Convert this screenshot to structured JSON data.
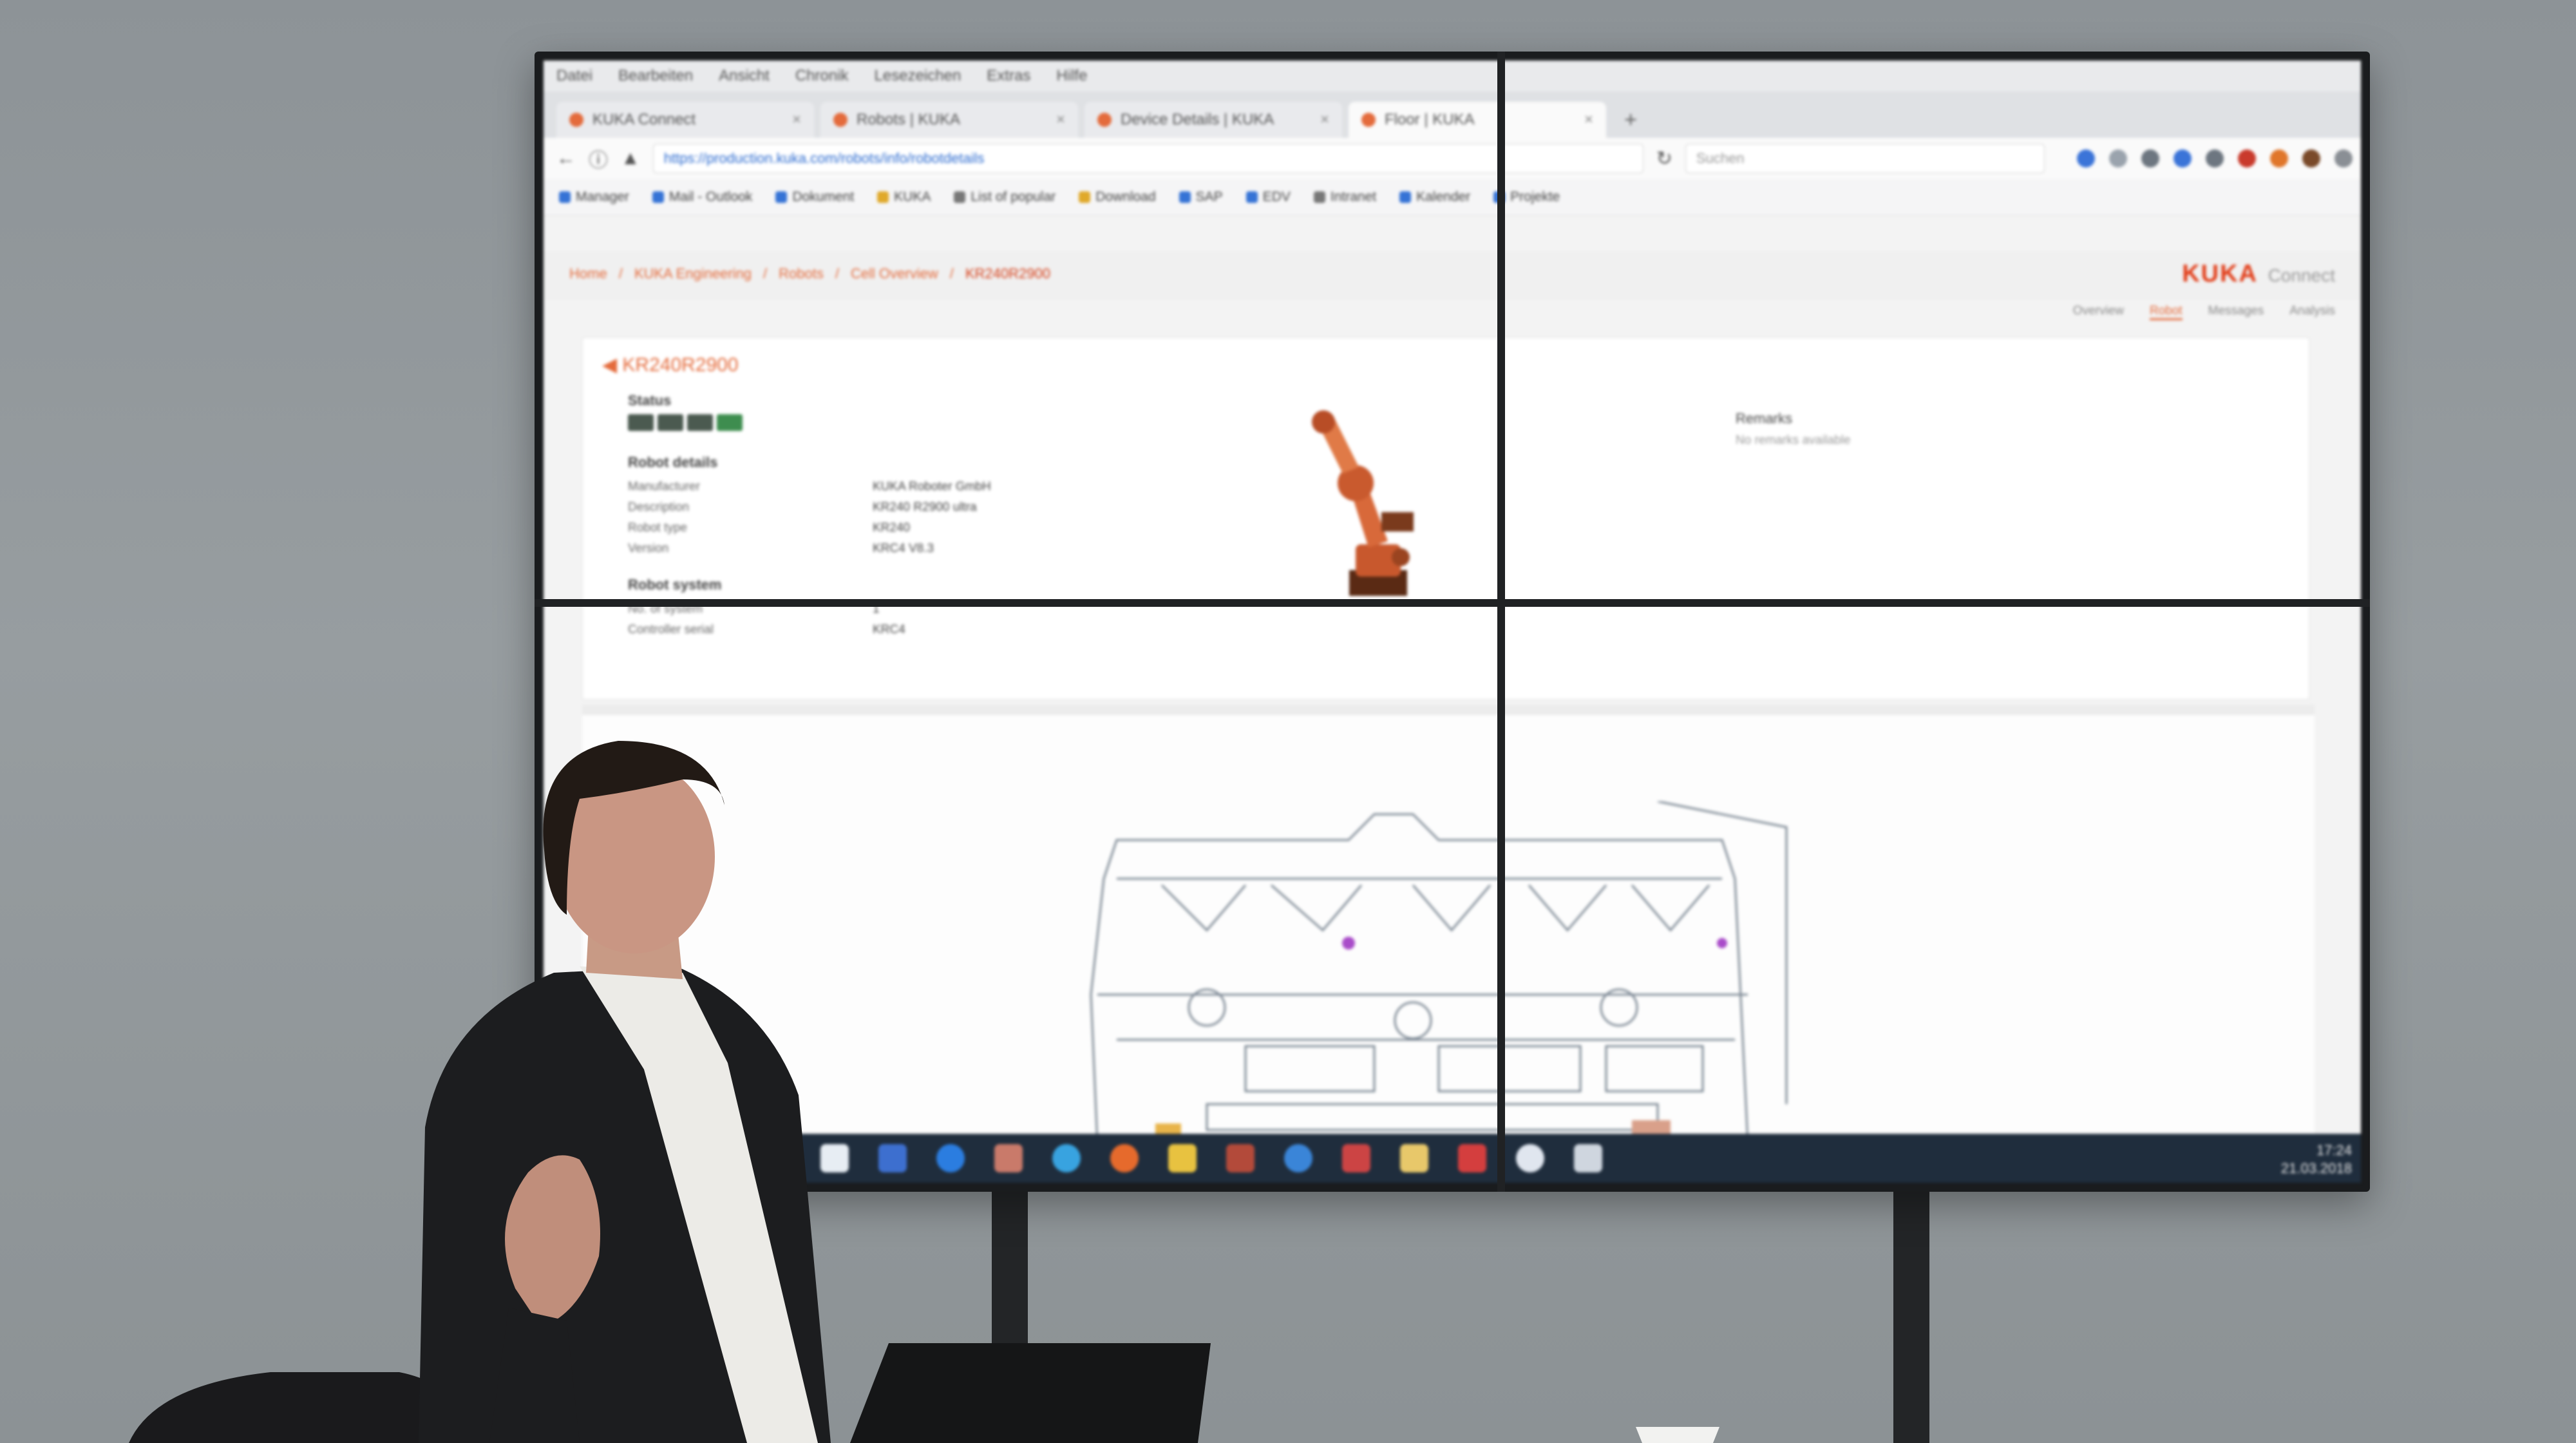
{
  "browser": {
    "menu": [
      "Datei",
      "Bearbeiten",
      "Ansicht",
      "Chronik",
      "Lesezeichen",
      "Extras",
      "Hilfe"
    ],
    "tabs": [
      {
        "label": "KUKA Connect",
        "active": false
      },
      {
        "label": "Robots | KUKA",
        "active": false
      },
      {
        "label": "Device Details | KUKA",
        "active": false
      },
      {
        "label": "Floor | KUKA",
        "active": true
      }
    ],
    "new_tab": "+",
    "url": "https://production.kuka.com/robots/info/robotdetails",
    "search_placeholder": "Suchen",
    "bookmarks": [
      "Manager",
      "Mail - Outlook",
      "Dokument",
      "KUKA",
      "List of popular",
      "Download",
      "SAP",
      "EDV",
      "Intranet",
      "Kalender",
      "Projekte"
    ]
  },
  "app": {
    "brand": "KUKA",
    "brand_sub": "Connect",
    "breadcrumb": [
      "Home",
      "KUKA Engineering",
      "Robots",
      "Cell Overview",
      "KR240R2900"
    ],
    "subtabs": [
      {
        "label": "Overview",
        "selected": false
      },
      {
        "label": "Robot",
        "selected": true
      },
      {
        "label": "Messages",
        "selected": false
      },
      {
        "label": "Analysis",
        "selected": false
      }
    ],
    "card_title": "KR240R2900",
    "status_label": "Status",
    "robot_details_label": "Robot details",
    "details": [
      {
        "k": "Manufacturer",
        "v": "KUKA Roboter GmbH"
      },
      {
        "k": "Description",
        "v": "KR240 R2900 ultra"
      },
      {
        "k": "Robot type",
        "v": "KR240"
      },
      {
        "k": "Version",
        "v": "KRC4 V8.3"
      }
    ],
    "robot_system_label": "Robot system",
    "system": [
      {
        "k": "No. of system",
        "v": "1"
      },
      {
        "k": "Controller serial",
        "v": "KRC4"
      }
    ],
    "notes_title": "Remarks",
    "notes_sub": "No remarks available"
  },
  "taskbar": {
    "time": "17:24",
    "date": "21.03.2018"
  },
  "colors": {
    "accent": "#e46b3c",
    "brand": "#e23c17",
    "wall": "#1a1c1e",
    "taskbar": "#1f2d3d"
  }
}
